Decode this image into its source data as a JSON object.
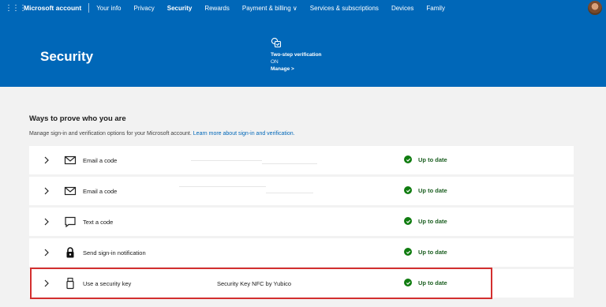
{
  "topnav": {
    "brand": "Microsoft account",
    "links": [
      "Your info",
      "Privacy",
      "Security",
      "Rewards",
      "Payment & billing ∨",
      "Services & subscriptions",
      "Devices",
      "Family"
    ]
  },
  "banner": {
    "title": "Security",
    "two_step": {
      "title": "Two-step verification",
      "status": "ON",
      "manage": "Manage >"
    }
  },
  "section": {
    "title": "Ways to prove who you are",
    "desc": "Manage sign-in and verification options for your Microsoft account.",
    "learn_more": "Learn more about sign-in and verification."
  },
  "rows": [
    {
      "label": "Email a code",
      "detail": "",
      "status": "Up to date",
      "icon": "mail-icon"
    },
    {
      "label": "Email a code",
      "detail": "",
      "status": "Up to date",
      "icon": "mail-icon"
    },
    {
      "label": "Text a code",
      "detail": "",
      "status": "Up to date",
      "icon": "chat-icon"
    },
    {
      "label": "Send sign-in notification",
      "detail": "",
      "status": "Up to date",
      "icon": "lock-icon"
    },
    {
      "label": "Use a security key",
      "detail": "Security Key NFC by Yubico",
      "status": "Up to date",
      "icon": "usb-key-icon"
    }
  ],
  "colors": {
    "accent": "#0067b8",
    "status_ok": "#107c10",
    "highlight": "#d32f2f"
  }
}
